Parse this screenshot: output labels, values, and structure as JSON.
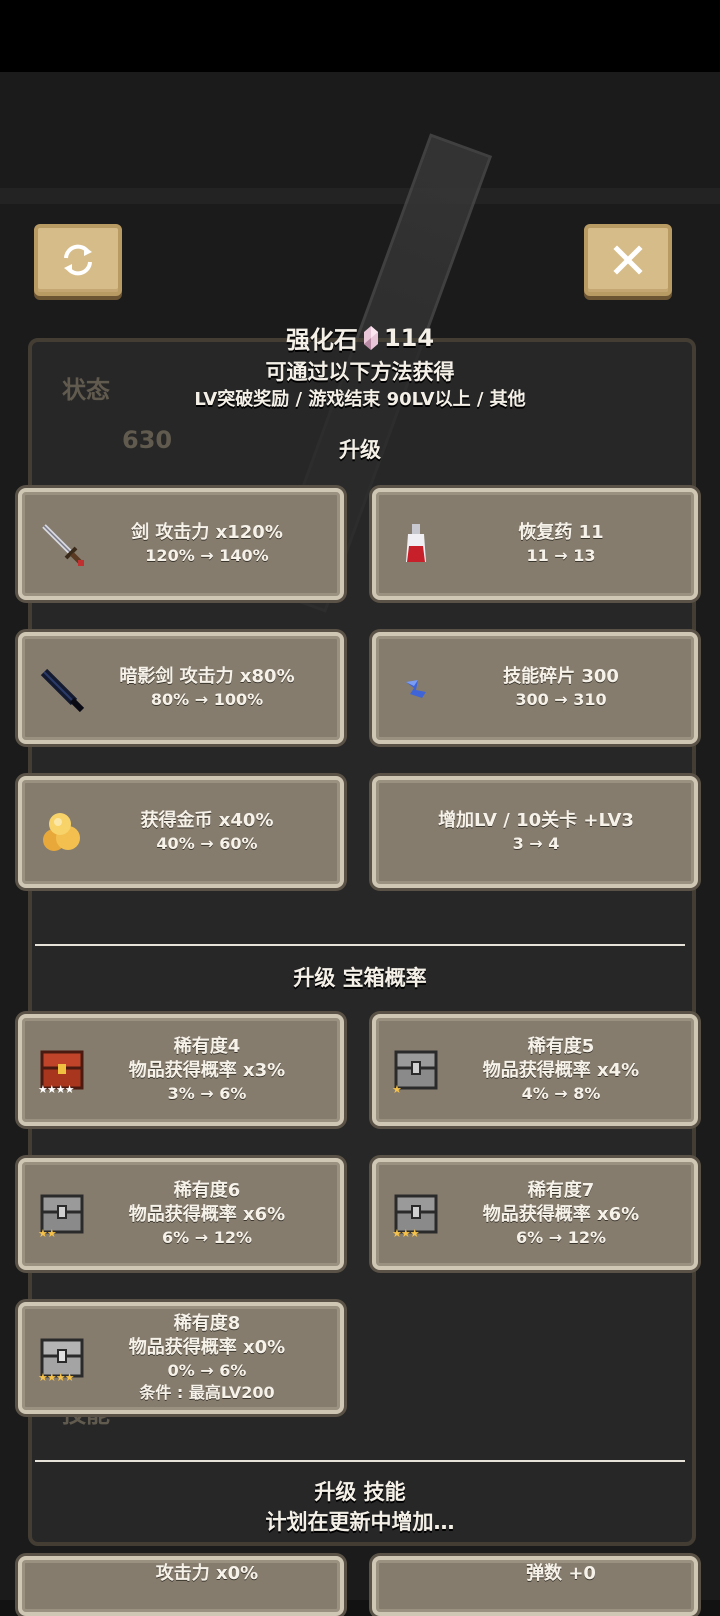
{
  "header": {
    "currency_name": "强化石",
    "currency_amount": "114",
    "subtitle": "可通过以下方法获得",
    "sources": "LV突破奖励 / 游戏结束 90LV以上 / 其他"
  },
  "background": {
    "status": "状态",
    "hp": "630",
    "skills": "技能",
    "x0": "x0",
    "x3": "x3"
  },
  "sections": {
    "upgrade": "升级",
    "upgrade_chest": "升级 宝箱概率",
    "upgrade_skill": "升级 技能",
    "planned": "计划在更新中增加…"
  },
  "upgrades": [
    {
      "icon": "sword-icon",
      "title": "剑 攻击力 x120%",
      "change": "120% → 140%"
    },
    {
      "icon": "potion-icon",
      "title": "恢复药 11",
      "change": "11 → 13"
    },
    {
      "icon": "shadow-sword-icon",
      "title": "暗影剑 攻击力 x80%",
      "change": "80% → 100%"
    },
    {
      "icon": "skill-shard-icon",
      "title": "技能碎片 300",
      "change": "300 → 310"
    },
    {
      "icon": "gold-coins-icon",
      "title": "获得金币 x40%",
      "change": "40% → 60%"
    },
    {
      "icon": "",
      "title": "增加LV / 10关卡 +LV3",
      "change": "3 → 4"
    }
  ],
  "chests": [
    {
      "icon": "chest-red-icon",
      "title": "稀有度4",
      "rate": "物品获得概率 x3%",
      "change": "3% → 6%",
      "stars": "★★★★"
    },
    {
      "icon": "chest-gray-icon",
      "title": "稀有度5",
      "rate": "物品获得概率 x4%",
      "change": "4% → 8%",
      "stars": "★"
    },
    {
      "icon": "chest-gray-icon",
      "title": "稀有度6",
      "rate": "物品获得概率 x6%",
      "change": "6% → 12%",
      "stars": "★★"
    },
    {
      "icon": "chest-gray-icon",
      "title": "稀有度7",
      "rate": "物品获得概率 x6%",
      "change": "6% → 12%",
      "stars": "★★★"
    },
    {
      "icon": "chest-gray-icon",
      "title": "稀有度8",
      "rate": "物品获得概率 x0%",
      "change": "0% → 6%",
      "condition": "条件 : 最高LV200",
      "stars": "★★★★"
    }
  ],
  "skills": [
    {
      "title": "攻击力 x0%"
    },
    {
      "title": "弹数 +0"
    }
  ],
  "colors": {
    "card_bg": "#857c6d",
    "card_border": "#cfc6b4",
    "button_bg": "#d6bc88"
  }
}
